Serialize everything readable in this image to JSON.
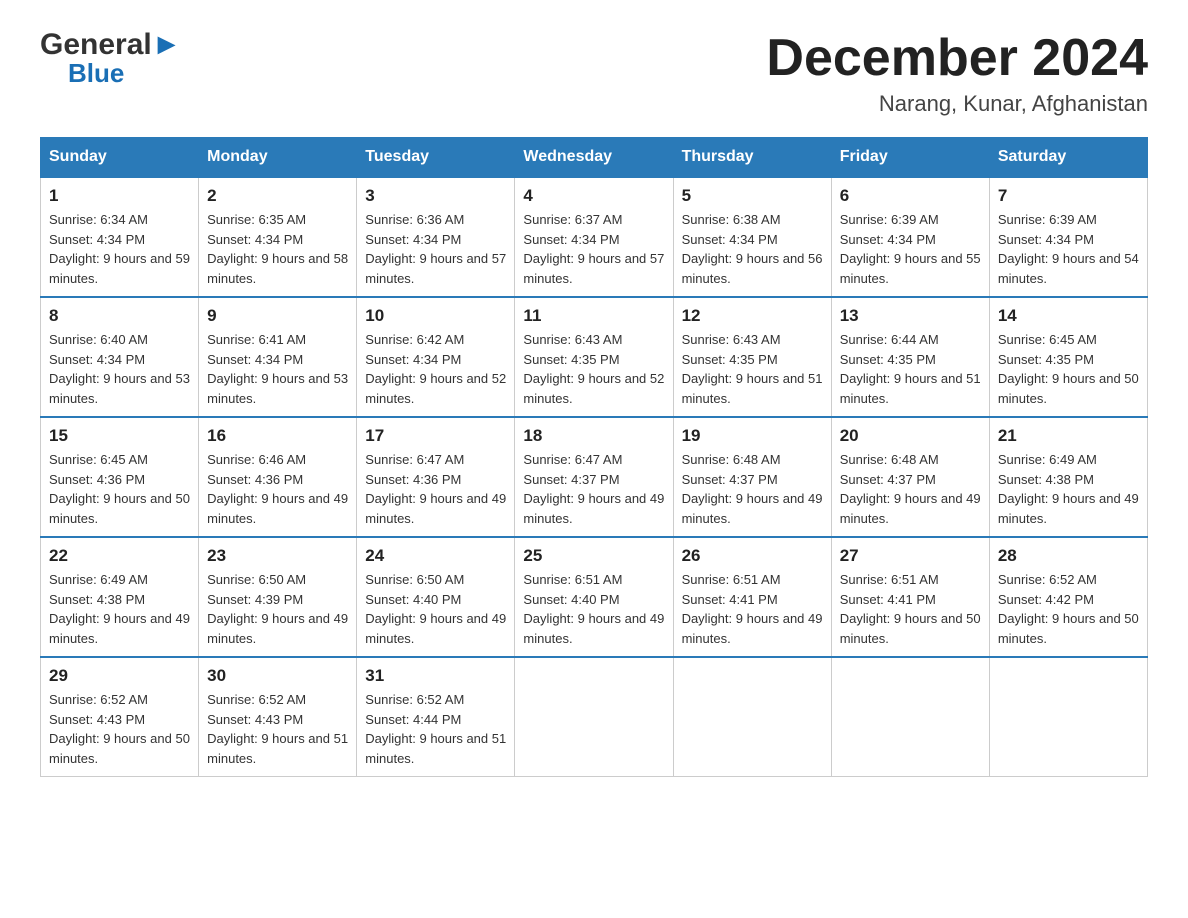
{
  "header": {
    "logo_general": "General",
    "logo_blue": "Blue",
    "title": "December 2024",
    "location": "Narang, Kunar, Afghanistan"
  },
  "days_of_week": [
    "Sunday",
    "Monday",
    "Tuesday",
    "Wednesday",
    "Thursday",
    "Friday",
    "Saturday"
  ],
  "weeks": [
    [
      {
        "day": "1",
        "sunrise": "Sunrise: 6:34 AM",
        "sunset": "Sunset: 4:34 PM",
        "daylight": "Daylight: 9 hours and 59 minutes."
      },
      {
        "day": "2",
        "sunrise": "Sunrise: 6:35 AM",
        "sunset": "Sunset: 4:34 PM",
        "daylight": "Daylight: 9 hours and 58 minutes."
      },
      {
        "day": "3",
        "sunrise": "Sunrise: 6:36 AM",
        "sunset": "Sunset: 4:34 PM",
        "daylight": "Daylight: 9 hours and 57 minutes."
      },
      {
        "day": "4",
        "sunrise": "Sunrise: 6:37 AM",
        "sunset": "Sunset: 4:34 PM",
        "daylight": "Daylight: 9 hours and 57 minutes."
      },
      {
        "day": "5",
        "sunrise": "Sunrise: 6:38 AM",
        "sunset": "Sunset: 4:34 PM",
        "daylight": "Daylight: 9 hours and 56 minutes."
      },
      {
        "day": "6",
        "sunrise": "Sunrise: 6:39 AM",
        "sunset": "Sunset: 4:34 PM",
        "daylight": "Daylight: 9 hours and 55 minutes."
      },
      {
        "day": "7",
        "sunrise": "Sunrise: 6:39 AM",
        "sunset": "Sunset: 4:34 PM",
        "daylight": "Daylight: 9 hours and 54 minutes."
      }
    ],
    [
      {
        "day": "8",
        "sunrise": "Sunrise: 6:40 AM",
        "sunset": "Sunset: 4:34 PM",
        "daylight": "Daylight: 9 hours and 53 minutes."
      },
      {
        "day": "9",
        "sunrise": "Sunrise: 6:41 AM",
        "sunset": "Sunset: 4:34 PM",
        "daylight": "Daylight: 9 hours and 53 minutes."
      },
      {
        "day": "10",
        "sunrise": "Sunrise: 6:42 AM",
        "sunset": "Sunset: 4:34 PM",
        "daylight": "Daylight: 9 hours and 52 minutes."
      },
      {
        "day": "11",
        "sunrise": "Sunrise: 6:43 AM",
        "sunset": "Sunset: 4:35 PM",
        "daylight": "Daylight: 9 hours and 52 minutes."
      },
      {
        "day": "12",
        "sunrise": "Sunrise: 6:43 AM",
        "sunset": "Sunset: 4:35 PM",
        "daylight": "Daylight: 9 hours and 51 minutes."
      },
      {
        "day": "13",
        "sunrise": "Sunrise: 6:44 AM",
        "sunset": "Sunset: 4:35 PM",
        "daylight": "Daylight: 9 hours and 51 minutes."
      },
      {
        "day": "14",
        "sunrise": "Sunrise: 6:45 AM",
        "sunset": "Sunset: 4:35 PM",
        "daylight": "Daylight: 9 hours and 50 minutes."
      }
    ],
    [
      {
        "day": "15",
        "sunrise": "Sunrise: 6:45 AM",
        "sunset": "Sunset: 4:36 PM",
        "daylight": "Daylight: 9 hours and 50 minutes."
      },
      {
        "day": "16",
        "sunrise": "Sunrise: 6:46 AM",
        "sunset": "Sunset: 4:36 PM",
        "daylight": "Daylight: 9 hours and 49 minutes."
      },
      {
        "day": "17",
        "sunrise": "Sunrise: 6:47 AM",
        "sunset": "Sunset: 4:36 PM",
        "daylight": "Daylight: 9 hours and 49 minutes."
      },
      {
        "day": "18",
        "sunrise": "Sunrise: 6:47 AM",
        "sunset": "Sunset: 4:37 PM",
        "daylight": "Daylight: 9 hours and 49 minutes."
      },
      {
        "day": "19",
        "sunrise": "Sunrise: 6:48 AM",
        "sunset": "Sunset: 4:37 PM",
        "daylight": "Daylight: 9 hours and 49 minutes."
      },
      {
        "day": "20",
        "sunrise": "Sunrise: 6:48 AM",
        "sunset": "Sunset: 4:37 PM",
        "daylight": "Daylight: 9 hours and 49 minutes."
      },
      {
        "day": "21",
        "sunrise": "Sunrise: 6:49 AM",
        "sunset": "Sunset: 4:38 PM",
        "daylight": "Daylight: 9 hours and 49 minutes."
      }
    ],
    [
      {
        "day": "22",
        "sunrise": "Sunrise: 6:49 AM",
        "sunset": "Sunset: 4:38 PM",
        "daylight": "Daylight: 9 hours and 49 minutes."
      },
      {
        "day": "23",
        "sunrise": "Sunrise: 6:50 AM",
        "sunset": "Sunset: 4:39 PM",
        "daylight": "Daylight: 9 hours and 49 minutes."
      },
      {
        "day": "24",
        "sunrise": "Sunrise: 6:50 AM",
        "sunset": "Sunset: 4:40 PM",
        "daylight": "Daylight: 9 hours and 49 minutes."
      },
      {
        "day": "25",
        "sunrise": "Sunrise: 6:51 AM",
        "sunset": "Sunset: 4:40 PM",
        "daylight": "Daylight: 9 hours and 49 minutes."
      },
      {
        "day": "26",
        "sunrise": "Sunrise: 6:51 AM",
        "sunset": "Sunset: 4:41 PM",
        "daylight": "Daylight: 9 hours and 49 minutes."
      },
      {
        "day": "27",
        "sunrise": "Sunrise: 6:51 AM",
        "sunset": "Sunset: 4:41 PM",
        "daylight": "Daylight: 9 hours and 50 minutes."
      },
      {
        "day": "28",
        "sunrise": "Sunrise: 6:52 AM",
        "sunset": "Sunset: 4:42 PM",
        "daylight": "Daylight: 9 hours and 50 minutes."
      }
    ],
    [
      {
        "day": "29",
        "sunrise": "Sunrise: 6:52 AM",
        "sunset": "Sunset: 4:43 PM",
        "daylight": "Daylight: 9 hours and 50 minutes."
      },
      {
        "day": "30",
        "sunrise": "Sunrise: 6:52 AM",
        "sunset": "Sunset: 4:43 PM",
        "daylight": "Daylight: 9 hours and 51 minutes."
      },
      {
        "day": "31",
        "sunrise": "Sunrise: 6:52 AM",
        "sunset": "Sunset: 4:44 PM",
        "daylight": "Daylight: 9 hours and 51 minutes."
      },
      null,
      null,
      null,
      null
    ]
  ],
  "colors": {
    "header_bg": "#2a7ab8",
    "header_text": "#ffffff",
    "border": "#cccccc"
  }
}
